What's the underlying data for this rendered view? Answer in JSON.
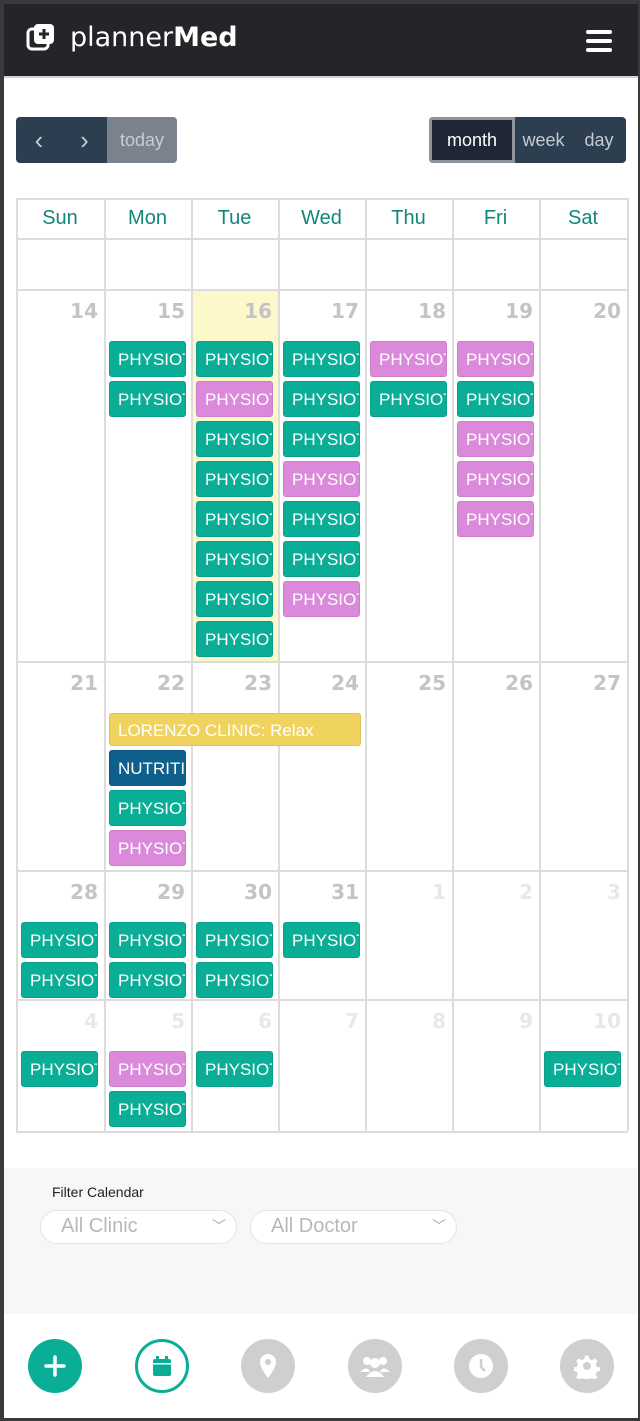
{
  "header": {
    "brand_light": "planner",
    "brand_bold": "Med",
    "logo_icon": "medical-plus-icon",
    "menu_icon": "hamburger-icon"
  },
  "toolbar": {
    "prev": "‹",
    "next": "›",
    "today": "today",
    "views": [
      "month",
      "week",
      "day"
    ],
    "active_view": "month"
  },
  "calendar": {
    "weekdays": [
      "Sun",
      "Mon",
      "Tue",
      "Wed",
      "Thu",
      "Fri",
      "Sat"
    ],
    "today_day": "16",
    "weeks": [
      {
        "days": [
          {
            "n": "14"
          },
          {
            "n": "15"
          },
          {
            "n": "16"
          },
          {
            "n": "17"
          },
          {
            "n": "18"
          },
          {
            "n": "19"
          },
          {
            "n": "20"
          }
        ],
        "events": [
          [],
          [
            "teal",
            "teal"
          ],
          [
            "teal",
            "pink",
            "teal",
            "teal",
            "teal",
            "teal",
            "teal",
            "teal"
          ],
          [
            "teal",
            "teal",
            "teal",
            "pink",
            "teal",
            "teal",
            "pink"
          ],
          [
            "pink",
            "teal"
          ],
          [
            "pink",
            "teal",
            "pink",
            "pink",
            "pink"
          ],
          []
        ]
      },
      {
        "days": [
          {
            "n": "21"
          },
          {
            "n": "22"
          },
          {
            "n": "23"
          },
          {
            "n": "24"
          },
          {
            "n": "25"
          },
          {
            "n": "26"
          },
          {
            "n": "27"
          }
        ],
        "span": {
          "label": "LORENZO CLINIC: Relax",
          "start": 1,
          "end": 4,
          "color": "yellow"
        },
        "events": [
          [],
          [
            "navy",
            "teal",
            "pink"
          ],
          [],
          [],
          [],
          [],
          []
        ]
      },
      {
        "days": [
          {
            "n": "28"
          },
          {
            "n": "29"
          },
          {
            "n": "30"
          },
          {
            "n": "31"
          },
          {
            "n": "1",
            "muted": true
          },
          {
            "n": "2",
            "muted": true
          },
          {
            "n": "3",
            "muted": true
          }
        ],
        "events": [
          [
            "teal",
            "teal"
          ],
          [
            "teal",
            "teal"
          ],
          [
            "teal",
            "teal"
          ],
          [
            "teal"
          ],
          [],
          [],
          []
        ]
      },
      {
        "days": [
          {
            "n": "4",
            "muted": true
          },
          {
            "n": "5",
            "muted": true
          },
          {
            "n": "6",
            "muted": true
          },
          {
            "n": "7",
            "muted": true
          },
          {
            "n": "8",
            "muted": true
          },
          {
            "n": "9",
            "muted": true
          },
          {
            "n": "10",
            "muted": true
          }
        ],
        "events": [
          [
            "teal"
          ],
          [
            "pink",
            "teal"
          ],
          [
            "teal"
          ],
          [],
          [],
          [],
          [
            "teal"
          ]
        ]
      }
    ],
    "event_labels": {
      "teal": "PHYSIOTHERAPY",
      "pink": "PHYSIOTHERAPY",
      "navy": "NUTRITION"
    },
    "colors": {
      "teal": "#0aae97",
      "pink": "#db8adb",
      "navy": "#0f5f8d",
      "yellow": "#f0d35e",
      "accent": "#0aae97"
    }
  },
  "filter": {
    "label": "Filter Calendar",
    "clinic": "All Clinic",
    "doctor": "All Doctor"
  },
  "bottom_nav": [
    "add-icon",
    "calendar-icon",
    "location-pin-icon",
    "users-icon",
    "clock-icon",
    "gear-icon"
  ]
}
